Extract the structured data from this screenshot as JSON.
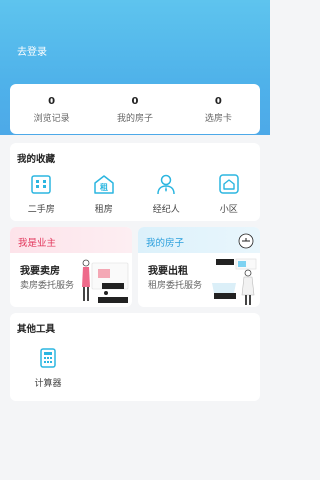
{
  "header": {
    "login_label": "去登录"
  },
  "stats": [
    {
      "value": "0",
      "label": "浏览记录"
    },
    {
      "value": "0",
      "label": "我的房子"
    },
    {
      "value": "0",
      "label": "选房卡"
    }
  ],
  "favorites": {
    "title": "我的收藏",
    "items": [
      {
        "label": "二手房",
        "icon": "building-icon"
      },
      {
        "label": "租房",
        "icon": "rent-house-icon"
      },
      {
        "label": "经纪人",
        "icon": "agent-icon"
      },
      {
        "label": "小区",
        "icon": "community-icon"
      }
    ]
  },
  "promos": {
    "sell": {
      "tag": "我是业主",
      "title": "我要卖房",
      "subtitle": "卖房委托服务"
    },
    "rent": {
      "tag": "我的房子",
      "title": "我要出租",
      "subtitle": "租房委托服务"
    }
  },
  "tools": {
    "title": "其他工具",
    "items": [
      {
        "label": "计算器",
        "icon": "calculator-icon"
      }
    ]
  },
  "colors": {
    "accent": "#2bb6e0",
    "header_gradient_top": "#5ec4ee",
    "sell_tag": "#e2375c",
    "rent_tag": "#2a9fdc"
  }
}
